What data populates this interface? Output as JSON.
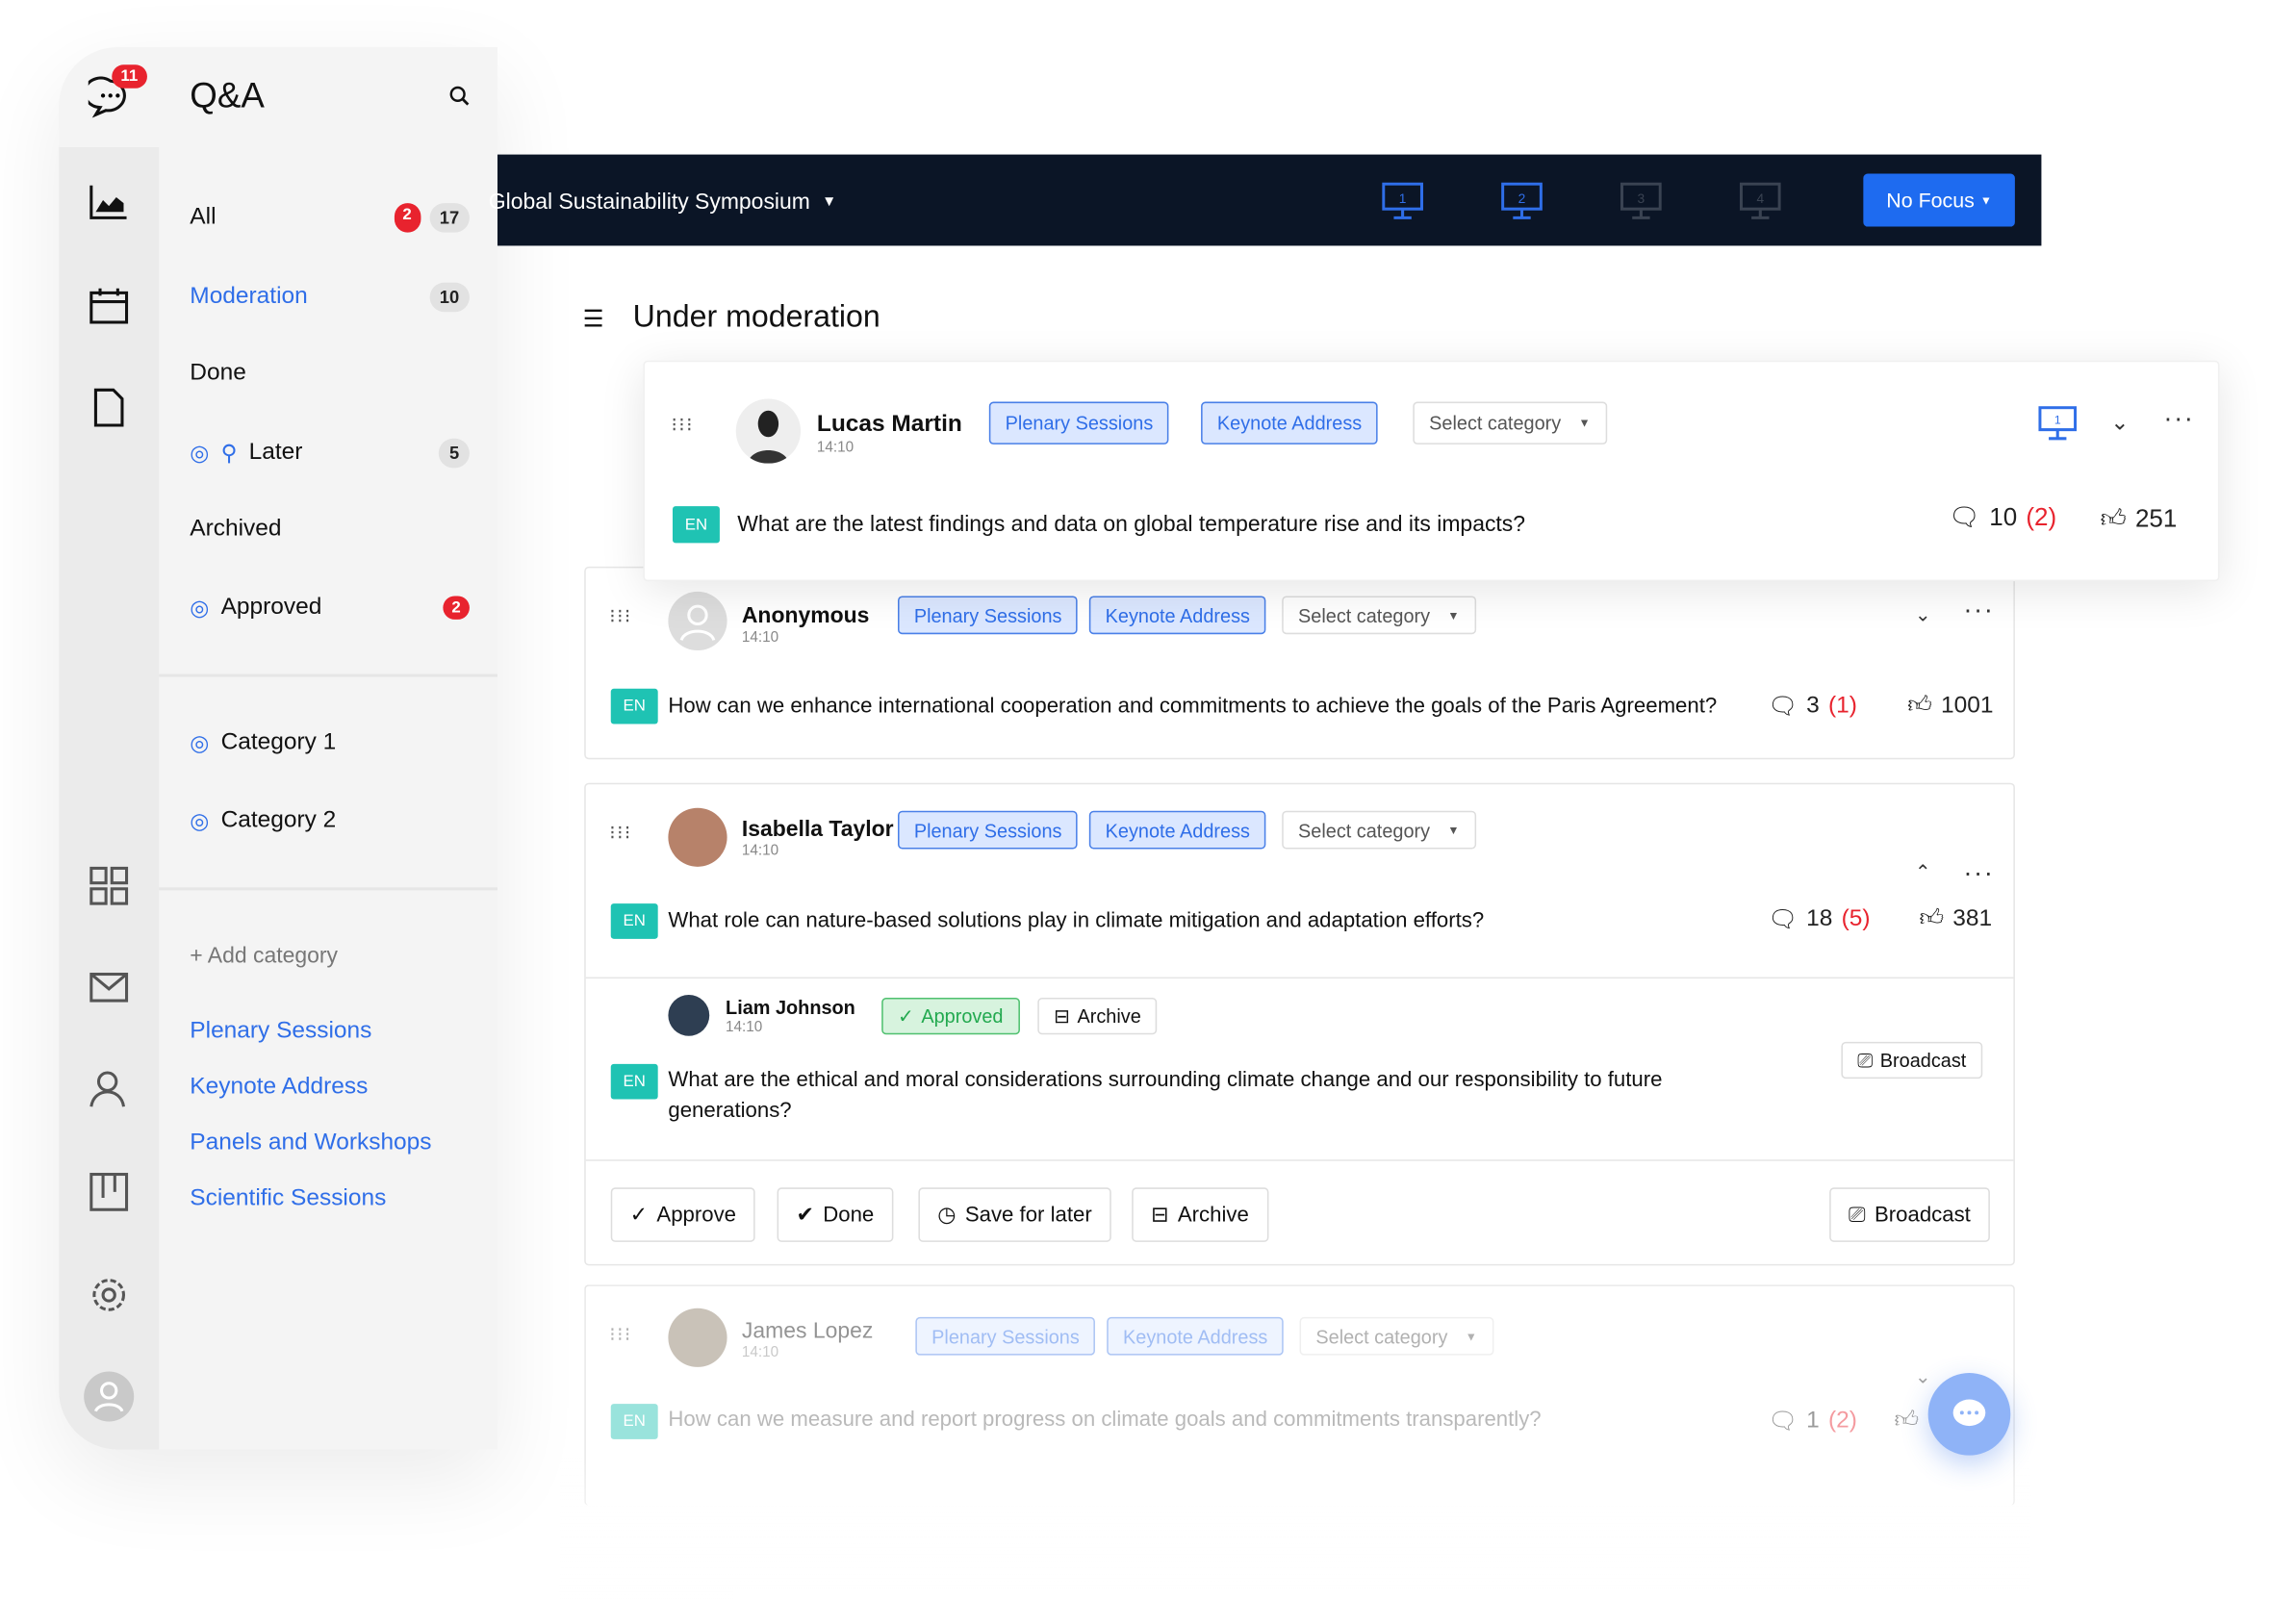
{
  "sidebar": {
    "title": "Q&A",
    "notification_count": "11",
    "nav": [
      {
        "label": "All",
        "alert": "2",
        "count": "17"
      },
      {
        "label": "Moderation",
        "count": "10",
        "active": true
      },
      {
        "label": "Done"
      },
      {
        "label": "Later",
        "count": "5"
      },
      {
        "label": "Archived"
      },
      {
        "label": "Approved",
        "alert": "2"
      }
    ],
    "categories": [
      "Category 1",
      "Category 2"
    ],
    "add_category": "+ Add category",
    "sessions": [
      "Plenary Sessions",
      "Keynote Address",
      "Panels and Workshops",
      "Scientific Sessions"
    ]
  },
  "topbar": {
    "event": "Global Sustainability Symposium",
    "screens": [
      "1",
      "2",
      "3",
      "4"
    ],
    "focus": "No Focus"
  },
  "main": {
    "title": "Under moderation"
  },
  "questions": [
    {
      "author": "Lucas Martin",
      "time": "14:10",
      "tags": [
        "Plenary Sessions",
        "Keynote Address"
      ],
      "select": "Select category",
      "lang": "EN",
      "text": "What are the latest findings and data on global temperature rise and its impacts?",
      "comments": "10",
      "new_comments": "(2)",
      "likes": "251",
      "screen": "1"
    },
    {
      "author": "Anonymous",
      "time": "14:10",
      "tags": [
        "Plenary Sessions",
        "Keynote Address"
      ],
      "select": "Select category",
      "lang": "EN",
      "text": "How can we enhance international cooperation and commitments to achieve the goals of the Paris Agreement?",
      "comments": "3",
      "new_comments": "(1)",
      "likes": "1001"
    },
    {
      "author": "Isabella Taylor",
      "time": "14:10",
      "tags": [
        "Plenary Sessions",
        "Keynote Address"
      ],
      "select": "Select category",
      "lang": "EN",
      "text": "What role can nature-based solutions play in climate mitigation and adaptation efforts?",
      "comments": "18",
      "new_comments": "(5)",
      "likes": "381",
      "reply": {
        "author": "Liam Johnson",
        "time": "14:10",
        "status": "Approved",
        "archive": "Archive",
        "broadcast": "Broadcast",
        "lang": "EN",
        "text": "What are the ethical and moral considerations surrounding climate change and our responsibility to future generations?"
      },
      "actions": {
        "approve": "Approve",
        "done": "Done",
        "later": "Save for later",
        "archive": "Archive",
        "broadcast": "Broadcast"
      }
    },
    {
      "author": "James Lopez",
      "time": "14:10",
      "tags": [
        "Plenary Sessions",
        "Keynote Address"
      ],
      "select": "Select category",
      "lang": "EN",
      "text": "How can we measure and report progress on climate goals and commitments transparently?",
      "comments": "1",
      "new_comments": "(2)",
      "likes": ""
    }
  ],
  "colors": {
    "accent": "#2f6ee8",
    "topbar": "#0b1526",
    "alert": "#e8232e",
    "lang_badge": "#1fc3b3",
    "approved": "#22a94f"
  }
}
